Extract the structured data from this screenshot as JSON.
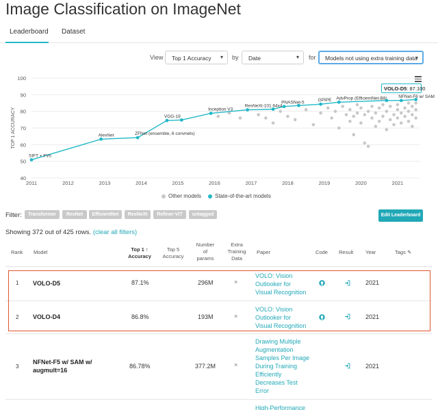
{
  "page": {
    "title": "Image Classification on ImageNet"
  },
  "tabs": [
    {
      "label": "Leaderboard"
    },
    {
      "label": "Dataset"
    }
  ],
  "controls": {
    "view_label": "View",
    "view_value": "Top 1 Accuracy",
    "by_label": "by",
    "by_value": "Date",
    "for_label": "for",
    "for_value": "Models not using extra training data"
  },
  "chart_data": {
    "type": "scatter",
    "ylabel": "TOP 1 ACCURACY",
    "xlabel": "",
    "ylim": [
      40,
      100
    ],
    "xlim": [
      2011,
      2021.6
    ],
    "y_ticks": [
      40,
      50,
      60,
      70,
      80,
      90,
      100
    ],
    "x_ticks": [
      "2011",
      "2012",
      "2013",
      "2014",
      "2015",
      "2016",
      "2017",
      "2018",
      "2019",
      "2020",
      "2021"
    ],
    "grid": true,
    "legend_position": "bottom",
    "series": [
      {
        "name": "State-of-the-art models",
        "color": "#21b8c7",
        "points": [
          {
            "x": 2011.0,
            "y": 50.9,
            "label": "SIFT + FVs"
          },
          {
            "x": 2012.9,
            "y": 63.3,
            "label": "AlexNet"
          },
          {
            "x": 2013.9,
            "y": 64.2,
            "label": "ZFNet (ensemble, 6 convnets)"
          },
          {
            "x": 2014.7,
            "y": 74.5,
            "label": "VGG-19"
          },
          {
            "x": 2015.1,
            "y": 74.8,
            "label": ""
          },
          {
            "x": 2015.9,
            "y": 78.8,
            "label": "Inception V3"
          },
          {
            "x": 2016.9,
            "y": 80.9,
            "label": "ResNeXt-101 64x4"
          },
          {
            "x": 2017.6,
            "y": 81.3,
            "label": ""
          },
          {
            "x": 2017.9,
            "y": 82.9,
            "label": "PNASNet-5"
          },
          {
            "x": 2018.3,
            "y": 83.5,
            "label": ""
          },
          {
            "x": 2018.9,
            "y": 84.3,
            "label": "GPIPE"
          },
          {
            "x": 2019.4,
            "y": 85.5,
            "label": "AdvProp (EfficientNet-B8)"
          },
          {
            "x": 2020.7,
            "y": 86.5,
            "label": ""
          },
          {
            "x": 2021.1,
            "y": 86.5,
            "label": "NFNet-F6 w/ SAM"
          },
          {
            "x": 2021.5,
            "y": 87.1,
            "label": "VOLO-D5"
          }
        ]
      },
      {
        "name": "Other models",
        "color": "#c8c8c8",
        "points": [
          {
            "x": 2016.1,
            "y": 77
          },
          {
            "x": 2016.4,
            "y": 79
          },
          {
            "x": 2016.7,
            "y": 76
          },
          {
            "x": 2017.2,
            "y": 78
          },
          {
            "x": 2017.4,
            "y": 76
          },
          {
            "x": 2017.6,
            "y": 73
          },
          {
            "x": 2017.8,
            "y": 80
          },
          {
            "x": 2018.0,
            "y": 77
          },
          {
            "x": 2018.2,
            "y": 75
          },
          {
            "x": 2018.5,
            "y": 81
          },
          {
            "x": 2018.7,
            "y": 72
          },
          {
            "x": 2018.9,
            "y": 79
          },
          {
            "x": 2019.1,
            "y": 82
          },
          {
            "x": 2019.2,
            "y": 76
          },
          {
            "x": 2019.3,
            "y": 80
          },
          {
            "x": 2019.4,
            "y": 70
          },
          {
            "x": 2019.5,
            "y": 83
          },
          {
            "x": 2019.6,
            "y": 78
          },
          {
            "x": 2019.7,
            "y": 74
          },
          {
            "x": 2019.7,
            "y": 81
          },
          {
            "x": 2019.8,
            "y": 66
          },
          {
            "x": 2019.8,
            "y": 77
          },
          {
            "x": 2019.9,
            "y": 84
          },
          {
            "x": 2019.9,
            "y": 79
          },
          {
            "x": 2020.0,
            "y": 73
          },
          {
            "x": 2020.0,
            "y": 82
          },
          {
            "x": 2020.1,
            "y": 61
          },
          {
            "x": 2020.1,
            "y": 78
          },
          {
            "x": 2020.2,
            "y": 59
          },
          {
            "x": 2020.2,
            "y": 80
          },
          {
            "x": 2020.3,
            "y": 76
          },
          {
            "x": 2020.3,
            "y": 83
          },
          {
            "x": 2020.4,
            "y": 71
          },
          {
            "x": 2020.4,
            "y": 79
          },
          {
            "x": 2020.5,
            "y": 74
          },
          {
            "x": 2020.5,
            "y": 82
          },
          {
            "x": 2020.6,
            "y": 77
          },
          {
            "x": 2020.6,
            "y": 84
          },
          {
            "x": 2020.7,
            "y": 69
          },
          {
            "x": 2020.7,
            "y": 80
          },
          {
            "x": 2020.8,
            "y": 75
          },
          {
            "x": 2020.8,
            "y": 83
          },
          {
            "x": 2020.9,
            "y": 78
          },
          {
            "x": 2020.9,
            "y": 72
          },
          {
            "x": 2021.0,
            "y": 81
          },
          {
            "x": 2021.0,
            "y": 76
          },
          {
            "x": 2021.0,
            "y": 84
          },
          {
            "x": 2021.1,
            "y": 79
          },
          {
            "x": 2021.1,
            "y": 73
          },
          {
            "x": 2021.2,
            "y": 82
          },
          {
            "x": 2021.2,
            "y": 77
          },
          {
            "x": 2021.3,
            "y": 85
          },
          {
            "x": 2021.3,
            "y": 80
          },
          {
            "x": 2021.3,
            "y": 74
          },
          {
            "x": 2021.4,
            "y": 83
          },
          {
            "x": 2021.4,
            "y": 78
          },
          {
            "x": 2021.4,
            "y": 71
          },
          {
            "x": 2021.5,
            "y": 81
          },
          {
            "x": 2021.5,
            "y": 85
          },
          {
            "x": 2021.5,
            "y": 76
          }
        ]
      }
    ],
    "tooltip": {
      "model": "VOLO-D5",
      "value": "87.100"
    }
  },
  "legend": {
    "other": "Other models",
    "sota": "State-of-the-art models"
  },
  "filter": {
    "label": "Filter:",
    "tags": [
      "Transformer",
      "ResNet",
      "EfficientNet",
      "ResNeXt",
      "Refiner-ViT",
      "untagged"
    ],
    "edit_button": "Edit Leaderboard"
  },
  "showing": {
    "text": "Showing 372 out of 425 rows.",
    "clear": "(clear all filters)"
  },
  "table": {
    "headers": {
      "rank": "Rank",
      "model": "Model",
      "top1_a": "Top 1",
      "top1_b": "Accuracy",
      "top5_a": "Top 5",
      "top5_b": "Accuracy",
      "params_a": "Number",
      "params_b": "of",
      "params_c": "params",
      "extra_a": "Extra",
      "extra_b": "Training",
      "extra_c": "Data",
      "paper": "Paper",
      "code": "Code",
      "result": "Result",
      "year": "Year",
      "tags": "Tags"
    },
    "rows": [
      {
        "rank": "1",
        "model": "VOLO-D5",
        "top1": "87.1%",
        "params": "296M",
        "extra": "×",
        "paper": [
          "VOLO: Vision",
          "Outlooker for",
          "Visual Recognition"
        ],
        "year": "2021"
      },
      {
        "rank": "2",
        "model": "VOLO-D4",
        "top1": "86.8%",
        "params": "193M",
        "extra": "×",
        "paper": [
          "VOLO: Vision",
          "Outlooker for",
          "Visual Recognition"
        ],
        "year": "2021"
      },
      {
        "rank": "3",
        "model": [
          "NFNet-F5 w/ SAM w/",
          "augmult=16"
        ],
        "top1": "86.78%",
        "params": "377.2M",
        "extra": "×",
        "paper": [
          "Drawing Multiple",
          "Augmentation",
          "Samples Per Image",
          "During Training",
          "Efficiently",
          "Decreases Test",
          "Error"
        ],
        "year": "2021"
      },
      {
        "paper": [
          "High-Performance"
        ]
      }
    ]
  }
}
